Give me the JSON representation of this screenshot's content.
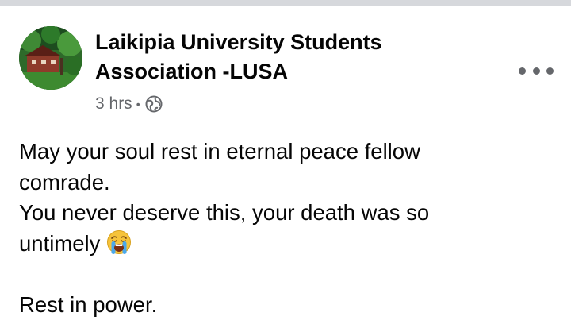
{
  "post": {
    "author": "Laikipia University Students Association -LUSA",
    "timestamp": "3 hrs",
    "separator": "•",
    "privacy_icon": "globe-icon",
    "more_icon": "more-options-icon",
    "text_lines": [
      "May your soul rest in eternal peace fellow",
      "comrade.",
      "You never deserve this, your death was so",
      "untimely",
      "",
      "Rest in power."
    ],
    "emoji": "loudly-crying-face-emoji"
  },
  "colors": {
    "name": "#050505",
    "meta": "#65676b",
    "top_bar": "#d6d8dc",
    "background": "#ffffff"
  }
}
